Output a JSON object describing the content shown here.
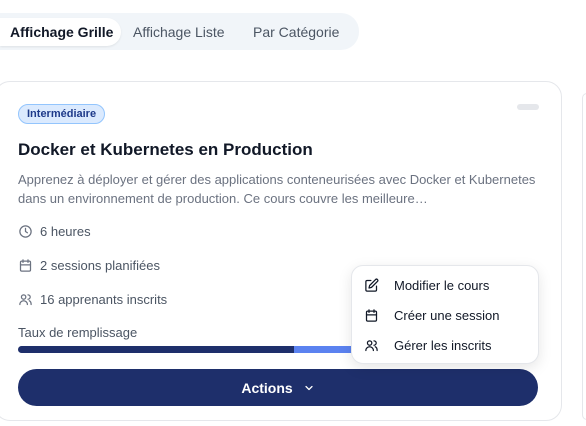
{
  "view_tabs": [
    {
      "label": "Affichage Grille",
      "active": true
    },
    {
      "label": "Affichage Liste",
      "active": false
    },
    {
      "label": "Par Catégorie",
      "active": false
    }
  ],
  "course": {
    "level_badge": "Intermédiaire",
    "title": "Docker et Kubernetes en Production",
    "description": "Apprenez à déployer et gérer des applications conteneurisées avec Docker et Kubernetes dans un environnement de production. Ce cours couvre les meilleure…",
    "duration": "6 heures",
    "sessions": "2 sessions planifiées",
    "enrolled": "16 apprenants inscrits",
    "fill_label": "Taux de remplissage",
    "fill_rate": 0.53,
    "fill_rate_secondary": 0.12
  },
  "actions": {
    "button_label": "Actions",
    "menu": [
      {
        "label": "Modifier le cours",
        "icon": "edit-icon"
      },
      {
        "label": "Créer une session",
        "icon": "calendar-icon"
      },
      {
        "label": "Gérer les inscrits",
        "icon": "users-icon"
      }
    ]
  },
  "colors": {
    "primary": "#1e2f6b",
    "progress_secondary": "#5b82f0",
    "badge_bg": "#dbeafe",
    "badge_text": "#1e3a8a"
  }
}
